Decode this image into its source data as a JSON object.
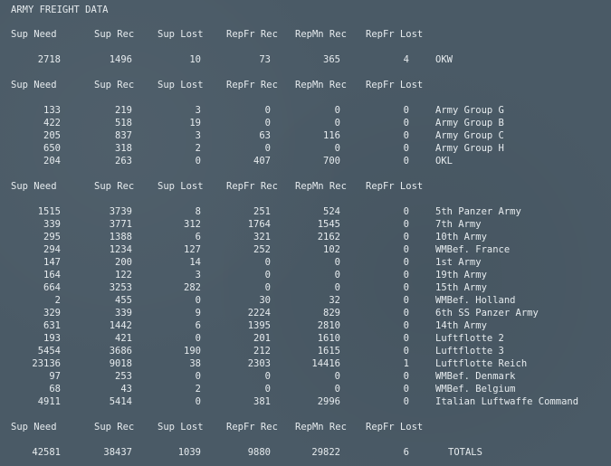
{
  "title": "ARMY FREIGHT DATA",
  "headers": [
    "Sup Need",
    "Sup Rec",
    "Sup Lost",
    "RepFr Rec",
    "RepMn Rec",
    "RepFr Lost"
  ],
  "sections": [
    {
      "rows": [
        [
          "2718",
          "1496",
          "10",
          "73",
          "365",
          "4",
          "OKW"
        ]
      ]
    },
    {
      "rows": [
        [
          "133",
          "219",
          "3",
          "0",
          "0",
          "0",
          "Army Group G"
        ],
        [
          "422",
          "518",
          "19",
          "0",
          "0",
          "0",
          "Army Group B"
        ],
        [
          "205",
          "837",
          "3",
          "63",
          "116",
          "0",
          "Army Group C"
        ],
        [
          "650",
          "318",
          "2",
          "0",
          "0",
          "0",
          "Army Group H"
        ],
        [
          "204",
          "263",
          "0",
          "407",
          "700",
          "0",
          "OKL"
        ]
      ]
    },
    {
      "rows": [
        [
          "1515",
          "3739",
          "8",
          "251",
          "524",
          "0",
          "5th Panzer Army"
        ],
        [
          "339",
          "3771",
          "312",
          "1764",
          "1545",
          "0",
          "7th Army"
        ],
        [
          "295",
          "1388",
          "6",
          "321",
          "2162",
          "0",
          "10th Army"
        ],
        [
          "294",
          "1234",
          "127",
          "252",
          "102",
          "0",
          "WMBef. France"
        ],
        [
          "147",
          "200",
          "14",
          "0",
          "0",
          "0",
          "1st Army"
        ],
        [
          "164",
          "122",
          "3",
          "0",
          "0",
          "0",
          "19th Army"
        ],
        [
          "664",
          "3253",
          "282",
          "0",
          "0",
          "0",
          "15th Army"
        ],
        [
          "2",
          "455",
          "0",
          "30",
          "32",
          "0",
          "WMBef. Holland"
        ],
        [
          "329",
          "339",
          "9",
          "2224",
          "829",
          "0",
          "6th SS Panzer Army"
        ],
        [
          "631",
          "1442",
          "6",
          "1395",
          "2810",
          "0",
          "14th Army"
        ],
        [
          "193",
          "421",
          "0",
          "201",
          "1610",
          "0",
          "Luftflotte 2"
        ],
        [
          "5454",
          "3686",
          "190",
          "212",
          "1615",
          "0",
          "Luftflotte 3"
        ],
        [
          "23136",
          "9018",
          "38",
          "2303",
          "14416",
          "1",
          "Luftflotte Reich"
        ],
        [
          "97",
          "253",
          "0",
          "0",
          "0",
          "0",
          "WMBef. Denmark"
        ],
        [
          "68",
          "43",
          "2",
          "0",
          "0",
          "0",
          "WMBef. Belgium"
        ],
        [
          "4911",
          "5414",
          "0",
          "381",
          "2996",
          "0",
          "Italian Luftwaffe Command"
        ]
      ]
    },
    {
      "rows": [
        [
          "42581",
          "38437",
          "1039",
          "9880",
          "29822",
          "6",
          "TOTALS"
        ]
      ]
    }
  ],
  "colors": {
    "background": "#4a5a66",
    "text": "#e6ebee"
  }
}
